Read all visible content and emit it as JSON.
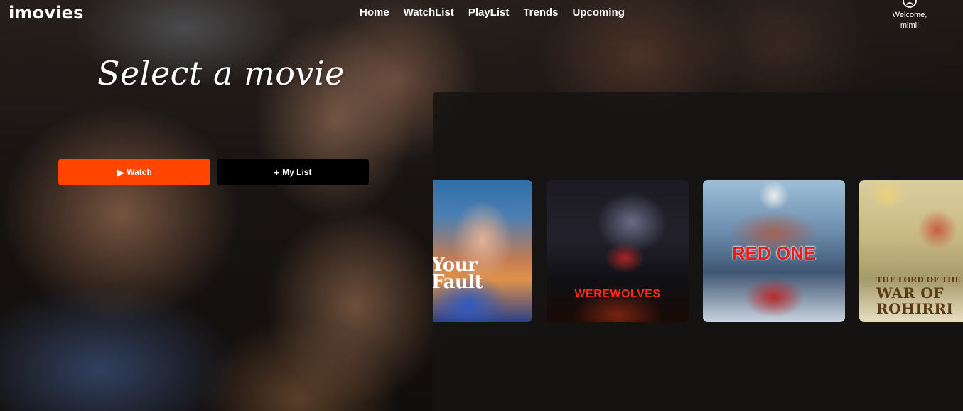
{
  "brand": {
    "logo": "imovies",
    "accent_color": "#ff4500"
  },
  "nav": {
    "items": [
      {
        "label": "Home"
      },
      {
        "label": "WatchList"
      },
      {
        "label": "PlayList"
      },
      {
        "label": "Trends"
      },
      {
        "label": "Upcoming"
      }
    ]
  },
  "user": {
    "icon": "user-circle-icon",
    "greeting_line1": "Welcome,",
    "greeting_line2": "mimi!"
  },
  "hero": {
    "title": "Select a movie",
    "watch_button": {
      "icon": "play-icon",
      "glyph": "▶",
      "label": "Watch"
    },
    "mylist_button": {
      "icon": "plus-icon",
      "glyph": "+",
      "label": "My List"
    }
  },
  "carousel": {
    "posters": [
      {
        "title_line1": "Your",
        "title_line2": "Fault"
      },
      {
        "title": "WEREWOLVES"
      },
      {
        "title": "RED ONE"
      },
      {
        "title_line1": "THE LORD OF THE R",
        "title_line2": "WAR OF",
        "title_line3": "ROHIRRI"
      }
    ]
  }
}
